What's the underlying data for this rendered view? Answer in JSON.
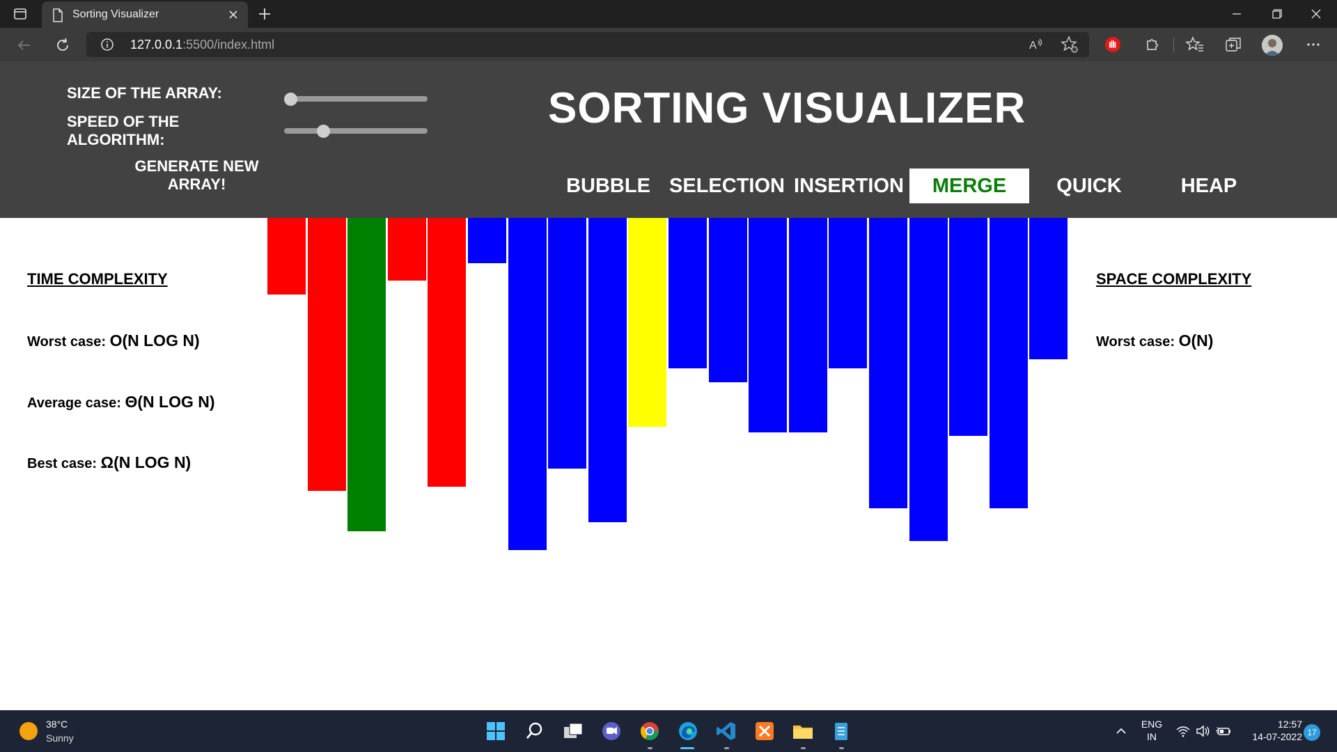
{
  "browser": {
    "tab_title": "Sorting Visualizer",
    "url_host": "127.0.0.1",
    "url_rest": ":5500/index.html"
  },
  "header": {
    "size_label": "SIZE OF THE ARRAY:",
    "speed_label_1": "SPEED OF THE",
    "speed_label_2": "ALGORITHM:",
    "size_value": 0.0,
    "speed_value": 0.25,
    "generate_line1": "GENERATE NEW",
    "generate_line2": "ARRAY!",
    "title": "SORTING VISUALIZER",
    "algorithms": [
      "BUBBLE",
      "SELECTION",
      "INSERTION",
      "MERGE",
      "QUICK",
      "HEAP"
    ],
    "active_algorithm": "MERGE"
  },
  "time_complexity": {
    "title": "TIME COMPLEXITY",
    "worst_label": "Worst case:",
    "worst_value": "O(N LOG N)",
    "average_label": "Average case:",
    "average_value": "Θ(N LOG N)",
    "best_label": "Best case:",
    "best_value": "Ω(N LOG N)"
  },
  "space_complexity": {
    "title": "SPACE COMPLEXITY",
    "worst_label": "Worst case:",
    "worst_value": "O(N)"
  },
  "array_bars": {
    "values": [
      110,
      392,
      450,
      90,
      386,
      65,
      477,
      360,
      437,
      300,
      216,
      236,
      308,
      308,
      216,
      417,
      464,
      313,
      417,
      203
    ],
    "colors": [
      "red",
      "red",
      "green",
      "red",
      "red",
      "blue",
      "blue",
      "blue",
      "blue",
      "yellow",
      "blue",
      "blue",
      "blue",
      "blue",
      "blue",
      "blue",
      "blue",
      "blue",
      "blue",
      "blue"
    ],
    "palette": {
      "red": "#ff0000",
      "green": "#008000",
      "blue": "#0000ff",
      "yellow": "#ffff00"
    }
  },
  "taskbar": {
    "temperature": "38°C",
    "condition": "Sunny",
    "lang_1": "ENG",
    "lang_2": "IN",
    "time": "12:57",
    "date": "14-07-2022",
    "notification_count": "17",
    "apps": [
      "start-icon",
      "search-icon",
      "task-view-icon",
      "teams-chat-icon",
      "chrome-icon",
      "edge-icon",
      "vscode-icon",
      "xampp-icon",
      "file-explorer-icon",
      "notepad-icon"
    ]
  }
}
